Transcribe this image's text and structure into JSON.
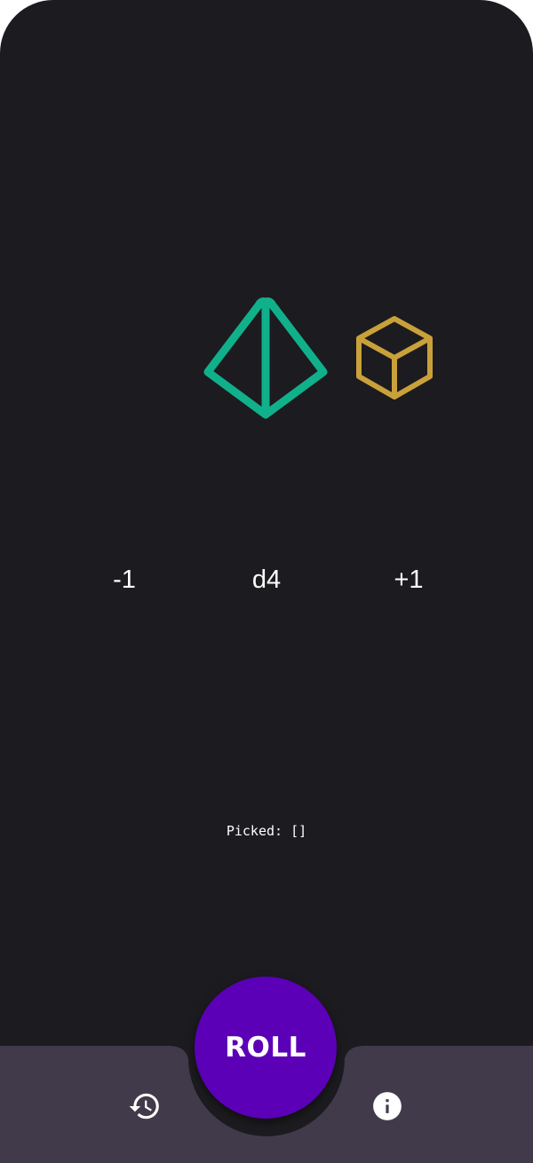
{
  "dice": [
    {
      "name": "d4",
      "icon": "tetrahedron-icon",
      "color": "#10b08b"
    },
    {
      "name": "d6",
      "icon": "cube-icon",
      "color": "#c9a13a"
    }
  ],
  "controls": {
    "decrement_label": "-1",
    "die_type": "d4",
    "increment_label": "+1"
  },
  "picked_text": "Picked: []",
  "roll_button": {
    "label": "ROLL",
    "color": "#5b00b7"
  },
  "bottom_bar": {
    "color": "#413a4a",
    "history_icon": "history-icon",
    "info_icon": "info-icon"
  },
  "background_color": "#1c1b1f"
}
